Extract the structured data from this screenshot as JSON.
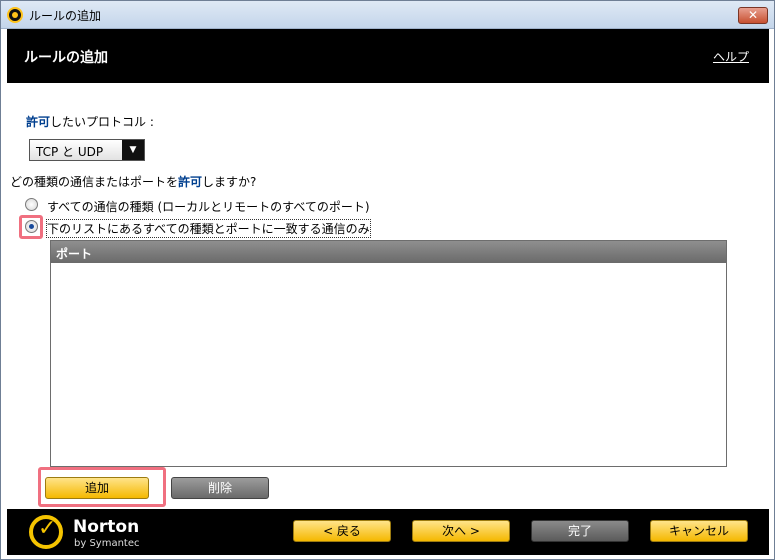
{
  "window": {
    "title": "ルールの追加",
    "close_label": "✕"
  },
  "header": {
    "title": "ルールの追加",
    "help_link": "ヘルプ"
  },
  "protocol": {
    "label_highlight": "許可",
    "label_rest": "したいプロトコル :",
    "selected": "TCP と UDP",
    "arrow": "▼"
  },
  "question": {
    "prefix": "どの種類の通信またはポートを",
    "highlight": "許可",
    "suffix": "しますか?"
  },
  "options": {
    "all": "すべての通信の種類 (ローカルとリモートのすべてのポート)",
    "list_only": "下のリストにあるすべての種類とポートに一致する通信のみ",
    "selected": "list_only"
  },
  "ports_list": {
    "header": "ポート",
    "items": []
  },
  "buttons": {
    "add": "追加",
    "delete": "削除",
    "back": "< 戻る",
    "next": "次へ >",
    "finish": "完了",
    "cancel": "キャンセル"
  },
  "branding": {
    "name": "Norton",
    "sub": "by Symantec"
  },
  "colors": {
    "accent_yellow": "#f5b800",
    "header_bg": "#000000",
    "highlight_box": "#f07080",
    "link_blue": "#003f8f"
  }
}
